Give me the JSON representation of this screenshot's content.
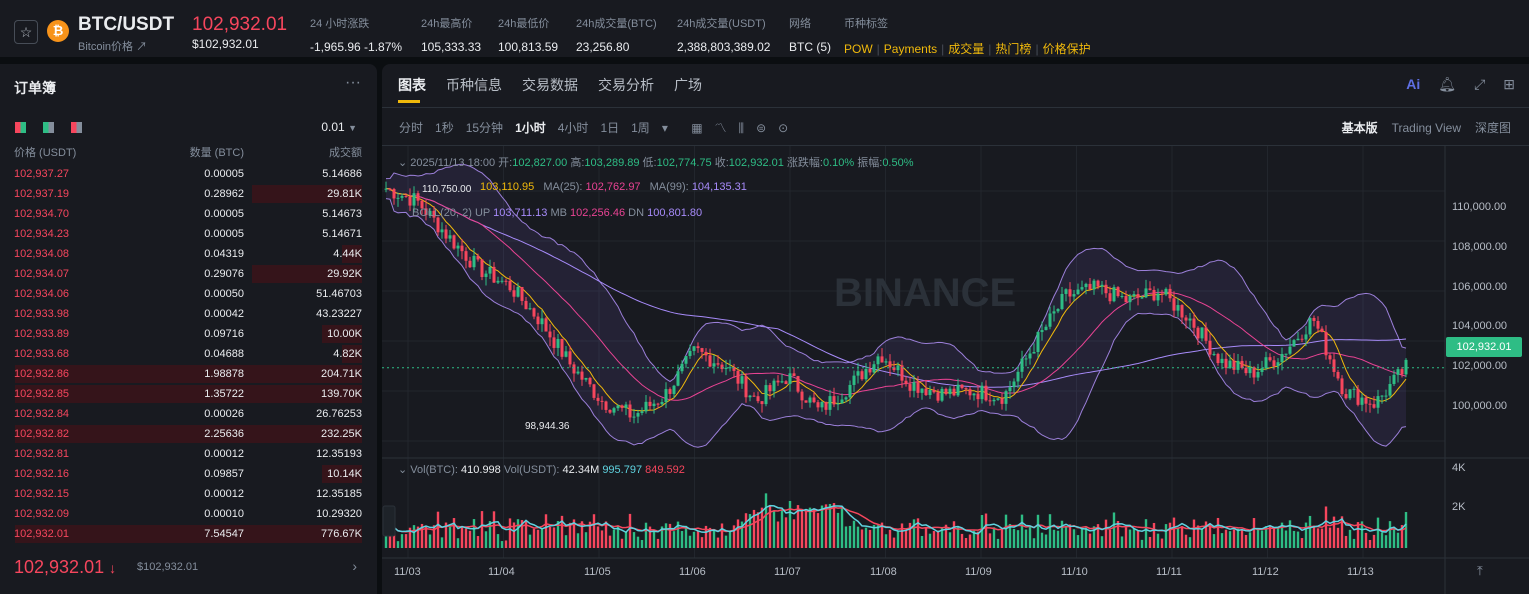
{
  "header": {
    "pair": "BTC/USDT",
    "subtitle": "Bitcoin价格 ↗",
    "price": "102,932.01",
    "price_usd": "$102,932.01",
    "stats": [
      {
        "label": "24 小时涨跌",
        "value": "-1,965.96 -1.87%"
      },
      {
        "label": "24h最高价",
        "value": "105,333.33"
      },
      {
        "label": "24h最低价",
        "value": "100,813.59"
      },
      {
        "label": "24h成交量(BTC)",
        "value": "23,256.80"
      },
      {
        "label": "24h成交量(USDT)",
        "value": "2,388,803,389.02"
      },
      {
        "label": "网络",
        "value": "BTC (5)"
      }
    ],
    "tags_label": "币种标签",
    "tags": [
      "POW",
      "Payments",
      "成交量",
      "热门榜",
      "价格保护"
    ]
  },
  "orderbook": {
    "title": "订单簿",
    "more": "···",
    "precision": "0.01",
    "headers": [
      "价格 (USDT)",
      "数量 (BTC)",
      "成交额"
    ],
    "rows": [
      {
        "price": "102,937.27",
        "qty": "0.00005",
        "total": "5.14686",
        "depth": 0.0
      },
      {
        "price": "102,937.19",
        "qty": "0.28962",
        "total": "29.81K",
        "depth": 0.11
      },
      {
        "price": "102,934.70",
        "qty": "0.00005",
        "total": "5.14673",
        "depth": 0.0
      },
      {
        "price": "102,934.23",
        "qty": "0.00005",
        "total": "5.14671",
        "depth": 0.0
      },
      {
        "price": "102,934.08",
        "qty": "0.04319",
        "total": "4.44K",
        "depth": 0.02
      },
      {
        "price": "102,934.07",
        "qty": "0.29076",
        "total": "29.92K",
        "depth": 0.11
      },
      {
        "price": "102,934.06",
        "qty": "0.00050",
        "total": "51.46703",
        "depth": 0.0
      },
      {
        "price": "102,933.98",
        "qty": "0.00042",
        "total": "43.23227",
        "depth": 0.0
      },
      {
        "price": "102,933.89",
        "qty": "0.09716",
        "total": "10.00K",
        "depth": 0.04
      },
      {
        "price": "102,933.68",
        "qty": "0.04688",
        "total": "4.82K",
        "depth": 0.02
      },
      {
        "price": "102,932.86",
        "qty": "1.98878",
        "total": "204.71K",
        "depth": 1.0
      },
      {
        "price": "102,932.85",
        "qty": "1.35722",
        "total": "139.70K",
        "depth": 1.0
      },
      {
        "price": "102,932.84",
        "qty": "0.00026",
        "total": "26.76253",
        "depth": 0.0
      },
      {
        "price": "102,932.82",
        "qty": "2.25636",
        "total": "232.25K",
        "depth": 1.0
      },
      {
        "price": "102,932.81",
        "qty": "0.00012",
        "total": "12.35193",
        "depth": 0.0
      },
      {
        "price": "102,932.16",
        "qty": "0.09857",
        "total": "10.14K",
        "depth": 0.04
      },
      {
        "price": "102,932.15",
        "qty": "0.00012",
        "total": "12.35185",
        "depth": 0.0
      },
      {
        "price": "102,932.09",
        "qty": "0.00010",
        "total": "10.29320",
        "depth": 0.0
      },
      {
        "price": "102,932.01",
        "qty": "7.54547",
        "total": "776.67K",
        "depth": 1.0
      }
    ],
    "last_price": "102,932.01",
    "last_arrow": "↓",
    "last_price_usd": "$102,932.01"
  },
  "panel": {
    "tabs": [
      "图表",
      "币种信息",
      "交易数据",
      "交易分析",
      "广场"
    ],
    "active_tab": 0,
    "intervals": [
      "分时",
      "1秒",
      "15分钟",
      "1小时",
      "4小时",
      "1日",
      "1周",
      "▾"
    ],
    "active_interval": 3,
    "views": [
      "基本版",
      "Trading View",
      "深度图"
    ],
    "active_view": 0
  },
  "chart": {
    "ohlc": {
      "date": "2025/11/13 18:00",
      "open_label": "开:",
      "open": "102,827.00",
      "high_label": "高:",
      "high": "103,289.89",
      "low_label": "低:",
      "low": "102,774.75",
      "close_label": "收:",
      "close": "102,932.01",
      "change_label": "涨跌幅:",
      "change": "0.10%",
      "amp_label": "振幅:",
      "amp": "0.50%"
    },
    "ma": {
      "ma7": "103,110.95",
      "ma25_label": "MA(25):",
      "ma25": "102,762.97",
      "ma99_label": "MA(99):",
      "ma99": "104,135.31"
    },
    "boll": {
      "label": "BOLL(20, 2)",
      "up_label": "UP",
      "up": "103,711.13",
      "mb_label": "MB",
      "mb": "102,256.46",
      "dn_label": "DN",
      "dn": "100,801.80"
    },
    "vol": {
      "label_btc": "Vol(BTC):",
      "btc": "410.998",
      "label_usdt": "Vol(USDT):",
      "usdt": "42.34M",
      "ma5": "995.797",
      "ma10": "849.592"
    },
    "high_mark": "110,750.00",
    "low_mark": "98,944.36",
    "current_price": "102,932.01",
    "y_ticks": [
      "110,000.00",
      "108,000.00",
      "106,000.00",
      "104,000.00",
      "102,000.00",
      "100,000.00"
    ],
    "vol_ticks": [
      "4K",
      "2K"
    ],
    "x_ticks": [
      "11/03",
      "11/04",
      "11/05",
      "11/06",
      "11/07",
      "11/08",
      "11/09",
      "11/10",
      "11/11",
      "11/12",
      "11/13"
    ],
    "watermark": "BINANCE",
    "colors": {
      "up": "#2ebd85",
      "down": "#f6465d",
      "ma7": "#f0b90b",
      "ma25": "#e84393",
      "ma99": "#a78bfa",
      "boll": "#9b7fd9"
    }
  },
  "chart_data": {
    "type": "candlestick",
    "x": [
      "11/03",
      "11/04",
      "11/05",
      "11/06",
      "11/07",
      "11/08",
      "11/09",
      "11/10",
      "11/11",
      "11/12",
      "11/13"
    ],
    "close_path": [
      110100,
      109600,
      108200,
      106900,
      106200,
      104800,
      103000,
      101600,
      101000,
      101800,
      103600,
      103000,
      101600,
      102600,
      101200,
      102200,
      103500,
      102300,
      101900,
      102000,
      101800,
      103900,
      105800,
      106100,
      105600,
      106000,
      104900,
      103200,
      102700,
      103500,
      104900,
      102000,
      101500,
      102932
    ],
    "ylim": [
      99000,
      111000
    ]
  }
}
